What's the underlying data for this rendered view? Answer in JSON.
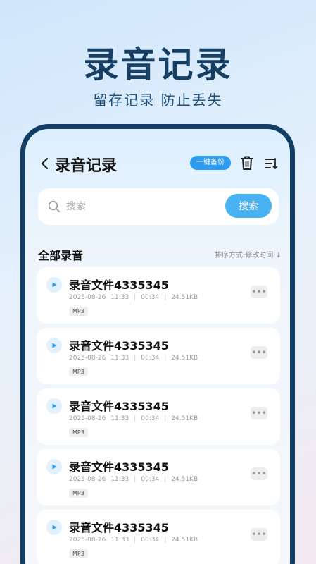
{
  "hero": {
    "title": "录音记录",
    "subtitle": "留存记录  防止丢失"
  },
  "app": {
    "title": "录音记录",
    "backup_label": "一键备份"
  },
  "search": {
    "placeholder": "搜索",
    "button_label": "搜索"
  },
  "section": {
    "title": "全部录音",
    "sort_label": "排序方式:修改时间 ↓"
  },
  "recordings": [
    {
      "name": "录音文件4335345",
      "date": "2025-08-26",
      "time": "11:33",
      "duration": "00:34",
      "size": "24.51KB",
      "format": "MP3"
    },
    {
      "name": "录音文件4335345",
      "date": "2025-08-26",
      "time": "11:33",
      "duration": "00:34",
      "size": "24.51KB",
      "format": "MP3"
    },
    {
      "name": "录音文件4335345",
      "date": "2025-08-26",
      "time": "11:33",
      "duration": "00:34",
      "size": "24.51KB",
      "format": "MP3"
    },
    {
      "name": "录音文件4335345",
      "date": "2025-08-26",
      "time": "11:33",
      "duration": "00:34",
      "size": "24.51KB",
      "format": "MP3"
    },
    {
      "name": "录音文件4335345",
      "date": "2025-08-26",
      "time": "11:33",
      "duration": "00:34",
      "size": "24.51KB",
      "format": "MP3"
    }
  ],
  "icons": {
    "back": "chevron-left-icon",
    "trash": "trash-icon",
    "sort": "sort-icon",
    "search": "search-icon",
    "play": "play-icon",
    "more": "more-icon"
  },
  "colors": {
    "brand_dark": "#123e66",
    "accent": "#2d9bef",
    "search_button": "#49b2f2"
  }
}
